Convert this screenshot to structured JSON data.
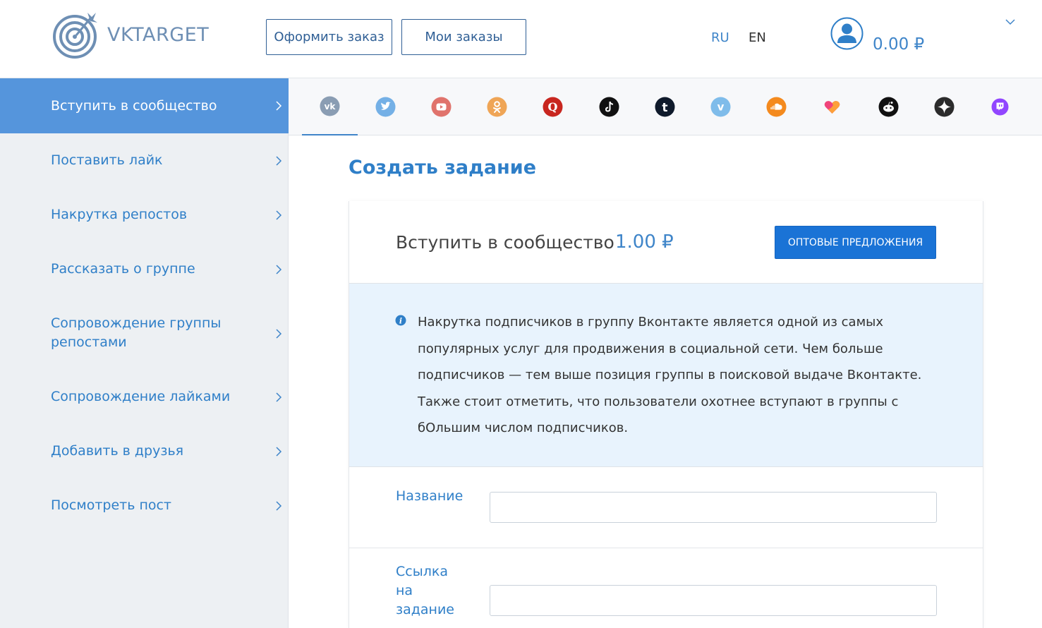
{
  "header": {
    "logo_text": "VKTARGET",
    "order_button": "Оформить заказ",
    "my_orders_button": "Мои заказы",
    "lang_ru": "RU",
    "lang_en": "EN",
    "balance": "0.00 ₽"
  },
  "sidebar": {
    "items": [
      {
        "label": "Вступить в сообщество",
        "active": true
      },
      {
        "label": "Поставить лайк"
      },
      {
        "label": "Накрутка репостов"
      },
      {
        "label": "Рассказать о группе"
      },
      {
        "label": "Сопровождение группы репостами"
      },
      {
        "label": "Сопровождение лайками"
      },
      {
        "label": "Добавить в друзья"
      },
      {
        "label": "Посмотреть пост"
      }
    ]
  },
  "social_tabs": [
    {
      "icon": "vk-icon",
      "color": "#8a9db3"
    },
    {
      "icon": "twitter-icon",
      "color": "#74b0e6"
    },
    {
      "icon": "youtube-icon",
      "color": "#e0736c"
    },
    {
      "icon": "odnoklassniki-icon",
      "color": "#efa556"
    },
    {
      "icon": "quora-icon",
      "color": "#c8261f"
    },
    {
      "icon": "tiktok-icon",
      "color": "#111111"
    },
    {
      "icon": "tumblr-icon",
      "color": "#0f1a2b"
    },
    {
      "icon": "vimeo-icon",
      "color": "#7fbcea"
    },
    {
      "icon": "soundcloud-icon",
      "color": "#f48a1e"
    },
    {
      "icon": "likee-icon",
      "color": "#f0447a"
    },
    {
      "icon": "reddit-icon",
      "color": "#111111"
    },
    {
      "icon": "zen-icon",
      "color": "#2b2b2b"
    },
    {
      "icon": "twitch-icon",
      "color": "#9146ff"
    }
  ],
  "main": {
    "title": "Создать задание",
    "service_name": "Вступить в сообщество",
    "service_price": "1.00 ₽",
    "wholesale_button": "ОПТОВЫЕ ПРЕДЛОЖЕНИЯ",
    "info_text": "Накрутка подписчиков в группу Вконтакте является одной из самых популярных услуг для продвижения в социальной сети. Чем больше подписчиков — тем выше позиция группы в поисковой выдаче Вконтакте. Также стоит отметить, что пользователи охотнее вступают в группы с бОльшим числом подписчиков.",
    "field_name_label": "Название",
    "field_name_value": "",
    "field_link_label": "Ссылка на задание",
    "field_link_value": ""
  },
  "colors": {
    "accent": "#3f85c9",
    "sidebar_active": "#5595dc",
    "button_primary": "#1a73d6",
    "info_bg": "#e8f3fd"
  }
}
